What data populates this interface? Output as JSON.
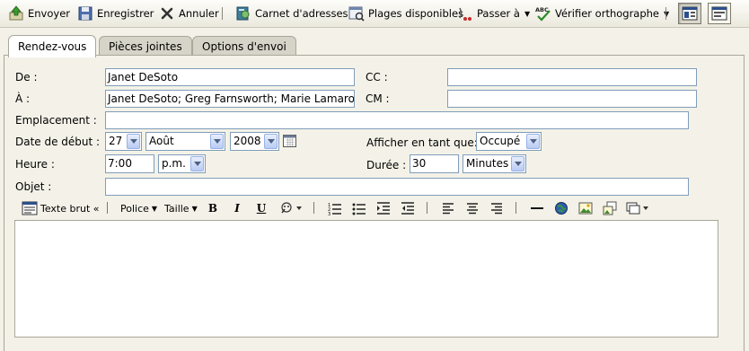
{
  "toolbar": {
    "send": "Envoyer",
    "save": "Enregistrer",
    "cancel": "Annuler",
    "address_book": "Carnet d'adresses",
    "availability": "Plages disponibles",
    "goto": "Passer à",
    "spellcheck": "Vérifier orthographe"
  },
  "tabs": [
    "Rendez-vous",
    "Pièces jointes",
    "Options d'envoi"
  ],
  "form": {
    "from_label": "De :",
    "from_value": "Janet DeSoto",
    "cc_label": "CC :",
    "cc_value": "",
    "to_label": "À :",
    "to_value": "Janet DeSoto; Greg Farnsworth; Marie Lamarou",
    "bcc_label": "CM :",
    "bcc_value": "",
    "location_label": "Emplacement :",
    "location_value": "",
    "start_date_label": "Date de début :",
    "day": "27",
    "month": "Août",
    "year": "2008",
    "show_as_label": "Afficher en tant que:",
    "show_as": "Occupé",
    "time_label": "Heure :",
    "time": "7:00",
    "ampm": "p.m.",
    "duration_label": "Durée :",
    "duration": "30",
    "duration_unit": "Minutes",
    "subject_label": "Objet :",
    "subject_value": ""
  },
  "editor": {
    "plain_text": "Texte brut «",
    "font": "Police",
    "size": "Taille",
    "bold": "B",
    "italic": "I",
    "underline": "U",
    "body": ""
  },
  "colors": {
    "background": "#f4f2e8",
    "input_border": "#7f9db9",
    "tab_inactive": "#d6d4c8"
  }
}
